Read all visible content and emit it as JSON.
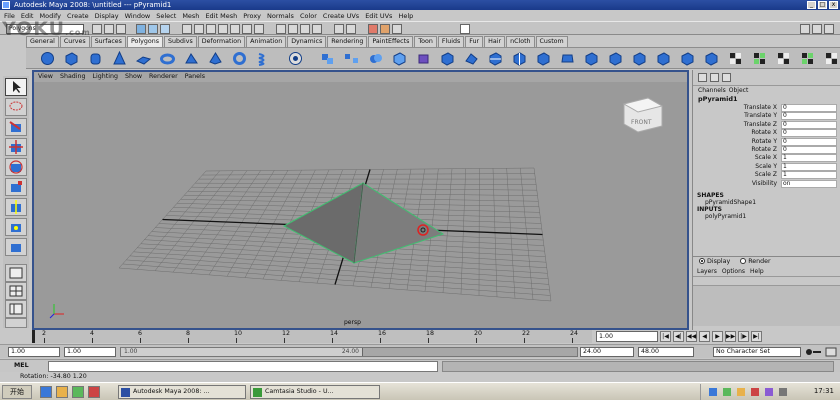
{
  "window": {
    "title": "Autodesk Maya 2008: \\untitled    ---    pPyramid1",
    "min": "_",
    "max": "□",
    "close": "x"
  },
  "menubar": [
    "File",
    "Edit",
    "Modify",
    "Create",
    "Display",
    "Window",
    "Select",
    "Mesh",
    "Edit Mesh",
    "Proxy",
    "Normals",
    "Color",
    "Create UVs",
    "Edit UVs",
    "Help"
  ],
  "statusline": {
    "mode": "Polygons"
  },
  "shelf_tabs": [
    {
      "label": "General"
    },
    {
      "label": "Curves"
    },
    {
      "label": "Surfaces"
    },
    {
      "label": "Polygons",
      "active": true
    },
    {
      "label": "Subdivs"
    },
    {
      "label": "Deformation"
    },
    {
      "label": "Animation"
    },
    {
      "label": "Dynamics"
    },
    {
      "label": "Rendering"
    },
    {
      "label": "PaintEffects"
    },
    {
      "label": "Toon"
    },
    {
      "label": "Fluids"
    },
    {
      "label": "Fur"
    },
    {
      "label": "Hair"
    },
    {
      "label": "nCloth"
    },
    {
      "label": "Custom"
    }
  ],
  "viewport": {
    "panel_menu": [
      "View",
      "Shading",
      "Lighting",
      "Show",
      "Renderer",
      "Panels"
    ],
    "camera": "persp",
    "viewcube": "FRONT"
  },
  "channel_box": {
    "tabs": [
      "Channels",
      "Object"
    ],
    "node": "pPyramid1",
    "attributes": [
      {
        "name": "Translate X",
        "value": "0"
      },
      {
        "name": "Translate Y",
        "value": "0"
      },
      {
        "name": "Translate Z",
        "value": "0"
      },
      {
        "name": "Rotate X",
        "value": "0"
      },
      {
        "name": "Rotate Y",
        "value": "0"
      },
      {
        "name": "Rotate Z",
        "value": "0"
      },
      {
        "name": "Scale X",
        "value": "1"
      },
      {
        "name": "Scale Y",
        "value": "1"
      },
      {
        "name": "Scale Z",
        "value": "1"
      },
      {
        "name": "Visibility",
        "value": "on"
      }
    ],
    "shapes_header": "SHAPES",
    "shape_node": "pPyramidShape1",
    "inputs_header": "INPUTS",
    "input_node": "polyPyramid1"
  },
  "layer_editor": {
    "display_label": "Display",
    "render_label": "Render",
    "menu": [
      "Layers",
      "Options",
      "Help"
    ]
  },
  "time_slider": {
    "ticks": [
      "2",
      "4",
      "6",
      "8",
      "10",
      "12",
      "14",
      "16",
      "18",
      "20",
      "22",
      "24"
    ],
    "current_time": "1.00"
  },
  "range_slider": {
    "start_time": "1.00",
    "playback_start": "1.00",
    "handle_start": "1.00",
    "handle_end": "24.00",
    "playback_end": "24.00",
    "end_time": "48.00",
    "character_set": "No Character Set"
  },
  "command_line": {
    "label": "MEL"
  },
  "help_line": {
    "text": "Rotation: -34.80   1.20"
  },
  "taskbar": {
    "start": "开始",
    "tasks": [
      "Autodesk Maya 2008: ...",
      "Camtasia Studio - U..."
    ],
    "clock": "17:31"
  },
  "watermark": {
    "text": "YOKU",
    "sub": ".com"
  }
}
